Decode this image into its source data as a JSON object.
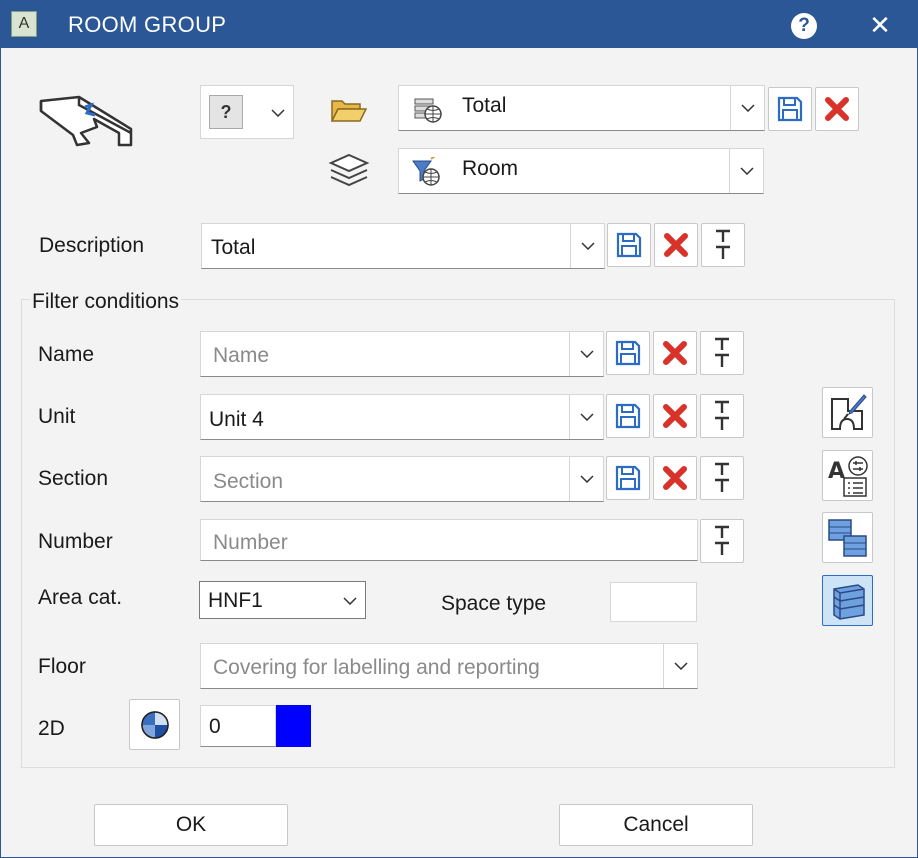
{
  "window": {
    "title": "ROOM GROUP",
    "help": "?",
    "close": "✕",
    "app_icon_letter": "A"
  },
  "top": {
    "type_selector_value": "?",
    "favorite": {
      "value": "Total"
    },
    "layer": {
      "value": "Room"
    }
  },
  "description": {
    "label": "Description",
    "value": "Total"
  },
  "filter": {
    "title": "Filter conditions",
    "name": {
      "label": "Name",
      "placeholder": "Name"
    },
    "unit": {
      "label": "Unit",
      "value": "Unit 4"
    },
    "section": {
      "label": "Section",
      "placeholder": "Section"
    },
    "number": {
      "label": "Number",
      "placeholder": "Number"
    },
    "area_cat": {
      "label": "Area cat.",
      "value": "HNF1"
    },
    "space_type": {
      "label": "Space type",
      "value": ""
    },
    "floor": {
      "label": "Floor",
      "placeholder": "Covering for labelling and reporting"
    },
    "twod": {
      "label": "2D",
      "value": "0",
      "color": "#0000ff"
    }
  },
  "buttons": {
    "ok": "OK",
    "cancel": "Cancel"
  },
  "colors": {
    "titlebar": "#2b5797",
    "save_icon": "#2b6cc4",
    "delete_icon": "#d9322b"
  }
}
